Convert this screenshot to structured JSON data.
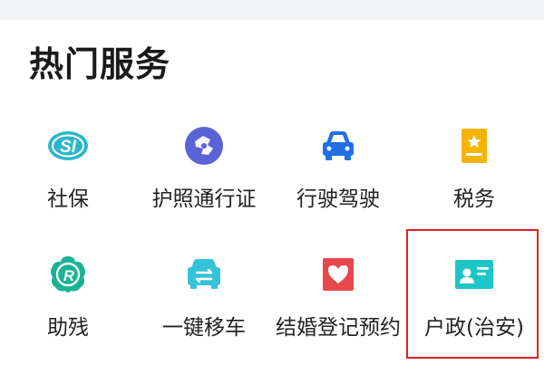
{
  "section": {
    "title": "热门服务"
  },
  "colors": {
    "teal": "#2bb7c9",
    "purple": "#5b63d6",
    "blue": "#1f6fe5",
    "yellow": "#f5b400",
    "green": "#18b394",
    "cyan": "#36c2d9",
    "red": "#e8474c",
    "aqua": "#1cc6c6",
    "highlight": "#e02020"
  },
  "services": [
    {
      "label": "社保",
      "icon": "social-security-icon"
    },
    {
      "label": "护照通行证",
      "icon": "passport-icon"
    },
    {
      "label": "行驶驾驶",
      "icon": "car-icon"
    },
    {
      "label": "税务",
      "icon": "tax-document-icon"
    },
    {
      "label": "助残",
      "icon": "disability-aid-icon"
    },
    {
      "label": "一键移车",
      "icon": "move-car-icon"
    },
    {
      "label": "结婚登记预约",
      "icon": "heart-certificate-icon"
    },
    {
      "label": "户政(治安)",
      "icon": "id-card-icon"
    }
  ]
}
